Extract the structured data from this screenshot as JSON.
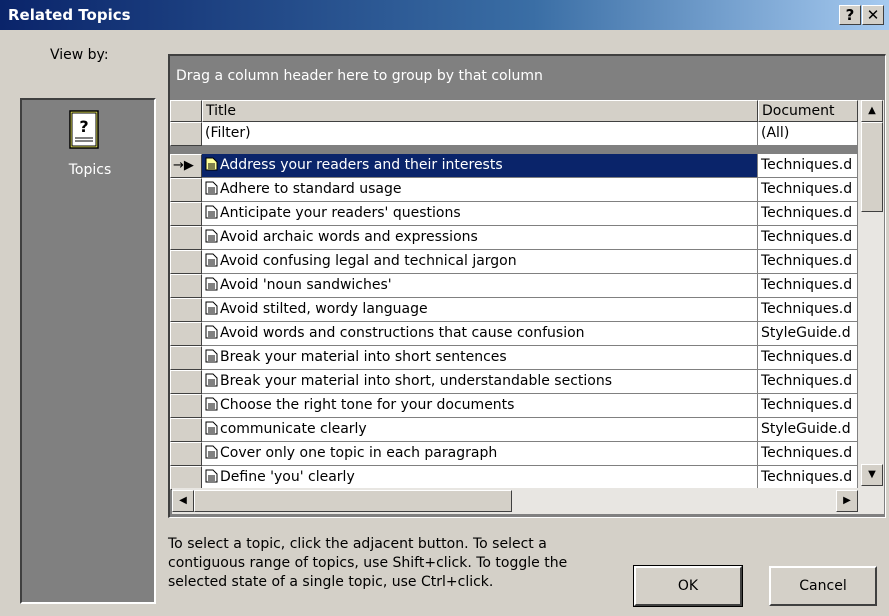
{
  "window": {
    "title": "Related Topics",
    "help_label": "?",
    "close_label": "✕"
  },
  "sidebar": {
    "caption": "View by:",
    "item_label": "Topics",
    "item_icon": "topics-book-icon"
  },
  "grid": {
    "group_hint": "Drag a column header here to group by that column",
    "columns": [
      "Title",
      "Document"
    ],
    "filter": {
      "title": "(Filter)",
      "document": "(All)"
    },
    "rows": [
      {
        "title": "Address your readers and their interests",
        "document": "Techniques.d",
        "selected": true
      },
      {
        "title": "Adhere to standard usage",
        "document": "Techniques.d"
      },
      {
        "title": "Anticipate your readers' questions",
        "document": "Techniques.d"
      },
      {
        "title": "Avoid archaic words and expressions",
        "document": "Techniques.d"
      },
      {
        "title": "Avoid confusing legal and technical jargon",
        "document": "Techniques.d"
      },
      {
        "title": "Avoid 'noun sandwiches'",
        "document": "Techniques.d"
      },
      {
        "title": "Avoid stilted, wordy language",
        "document": "Techniques.d"
      },
      {
        "title": "Avoid words and constructions that cause confusion",
        "document": "StyleGuide.d"
      },
      {
        "title": "Break your material into short sentences",
        "document": "Techniques.d"
      },
      {
        "title": "Break your material into short, understandable sections",
        "document": "Techniques.d"
      },
      {
        "title": "Choose the right tone for your documents",
        "document": "Techniques.d"
      },
      {
        "title": "communicate clearly",
        "document": "StyleGuide.d"
      },
      {
        "title": "Cover only one topic in each paragraph",
        "document": "Techniques.d"
      },
      {
        "title": "Define 'you' clearly",
        "document": "Techniques.d"
      }
    ],
    "vscroll_position": 0.0,
    "hscroll_position": 0.0
  },
  "footer": {
    "help_line1": "To select a topic, click the adjacent button. To select a",
    "help_line2": "contiguous range of topics, use Shift+click. To toggle the",
    "help_line3": "selected state of a single topic, use Ctrl+click.",
    "ok_label": "OK",
    "cancel_label": "Cancel"
  },
  "colors": {
    "selection": "#0a246a",
    "titlebar_start": "#0a246a",
    "titlebar_end": "#a6caf0",
    "panel": "#808080"
  }
}
